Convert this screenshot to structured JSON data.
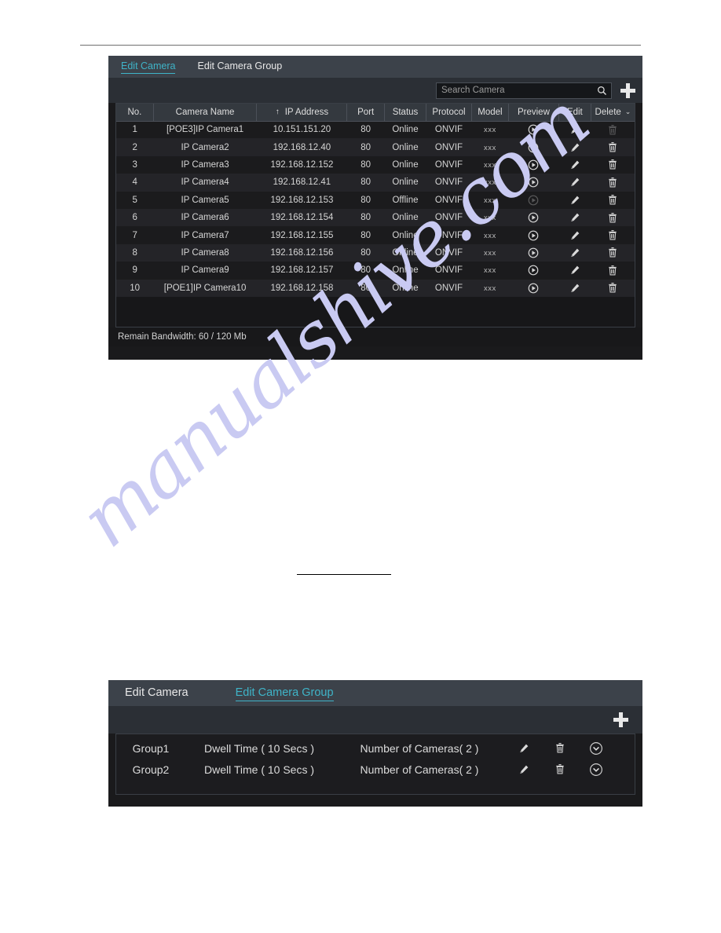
{
  "page": {
    "background": "#ffffff",
    "rule_color": "#6f6f6f",
    "watermark": "manualshive.com",
    "watermark_color": "#c9caf2"
  },
  "colors": {
    "panel_bg": "#1a1a1c",
    "tabbar_bg": "#3c424a",
    "toolbar_bg": "#2b2f35",
    "header_bg": "#34393f",
    "accent": "#3fb4c8",
    "text": "#dedede"
  },
  "camera_panel": {
    "tabs": [
      {
        "label": "Edit Camera",
        "active": true
      },
      {
        "label": "Edit Camera Group",
        "active": false
      }
    ],
    "search": {
      "placeholder": "Search Camera",
      "value": "",
      "icon": "search-icon"
    },
    "add_button": {
      "icon": "plus-icon",
      "label": "+"
    },
    "columns": [
      {
        "key": "no",
        "label": "No."
      },
      {
        "key": "name",
        "label": "Camera Name"
      },
      {
        "key": "ip",
        "label": "IP Address",
        "sort": "↑"
      },
      {
        "key": "port",
        "label": "Port"
      },
      {
        "key": "status",
        "label": "Status"
      },
      {
        "key": "protocol",
        "label": "Protocol"
      },
      {
        "key": "model",
        "label": "Model"
      },
      {
        "key": "preview",
        "label": "Preview"
      },
      {
        "key": "edit",
        "label": "Edit"
      },
      {
        "key": "delete",
        "label": "Delete",
        "chevron": "⌄"
      }
    ],
    "rows": [
      {
        "no": "1",
        "name": "[POE3]IP Camera1",
        "ip": "10.151.151.20",
        "port": "80",
        "status": "Online",
        "protocol": "ONVIF",
        "model": "xxx",
        "delete_enabled": false
      },
      {
        "no": "2",
        "name": "IP Camera2",
        "ip": "192.168.12.40",
        "port": "80",
        "status": "Online",
        "protocol": "ONVIF",
        "model": "xxx",
        "delete_enabled": true
      },
      {
        "no": "3",
        "name": "IP Camera3",
        "ip": "192.168.12.152",
        "port": "80",
        "status": "Online",
        "protocol": "ONVIF",
        "model": "xxx",
        "delete_enabled": true
      },
      {
        "no": "4",
        "name": "IP Camera4",
        "ip": "192.168.12.41",
        "port": "80",
        "status": "Online",
        "protocol": "ONVIF",
        "model": "xxx",
        "delete_enabled": true
      },
      {
        "no": "5",
        "name": "IP Camera5",
        "ip": "192.168.12.153",
        "port": "80",
        "status": "Offline",
        "protocol": "ONVIF",
        "model": "xxx",
        "delete_enabled": true
      },
      {
        "no": "6",
        "name": "IP Camera6",
        "ip": "192.168.12.154",
        "port": "80",
        "status": "Online",
        "protocol": "ONVIF",
        "model": "xxx",
        "delete_enabled": true
      },
      {
        "no": "7",
        "name": "IP Camera7",
        "ip": "192.168.12.155",
        "port": "80",
        "status": "Online",
        "protocol": "ONVIF",
        "model": "xxx",
        "delete_enabled": true
      },
      {
        "no": "8",
        "name": "IP Camera8",
        "ip": "192.168.12.156",
        "port": "80",
        "status": "Online",
        "protocol": "ONVIF",
        "model": "xxx",
        "delete_enabled": true
      },
      {
        "no": "9",
        "name": "IP Camera9",
        "ip": "192.168.12.157",
        "port": "80",
        "status": "Online",
        "protocol": "ONVIF",
        "model": "xxx",
        "delete_enabled": true
      },
      {
        "no": "10",
        "name": "[POE1]IP Camera10",
        "ip": "192.168.12.158",
        "port": "80",
        "status": "Online",
        "protocol": "ONVIF",
        "model": "xxx",
        "delete_enabled": true
      }
    ],
    "footer": "Remain Bandwidth: 60 / 120 Mb"
  },
  "group_panel": {
    "tabs": [
      {
        "label": "Edit Camera",
        "active": false
      },
      {
        "label": "Edit Camera Group",
        "active": true
      }
    ],
    "add_button": {
      "icon": "plus-icon",
      "label": "+"
    },
    "rows": [
      {
        "name": "Group1",
        "dwell": "Dwell Time ( 10 Secs )",
        "count": "Number of Cameras( 2 )"
      },
      {
        "name": "Group2",
        "dwell": "Dwell Time ( 10 Secs )",
        "count": "Number of Cameras( 2 )"
      }
    ]
  }
}
